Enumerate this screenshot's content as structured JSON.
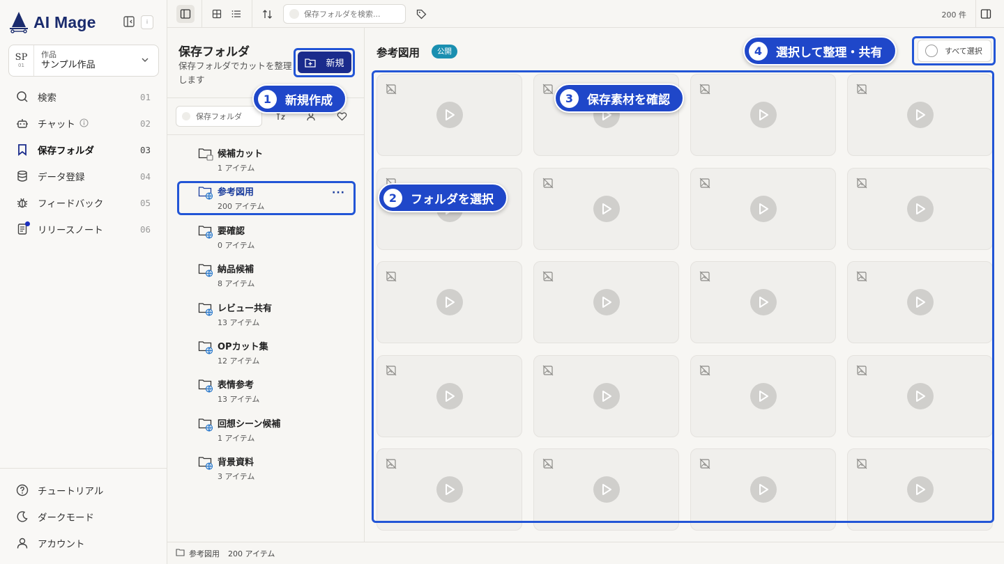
{
  "brand": {
    "name": "AI Mage"
  },
  "sidebar": {
    "kbd_hint": "i",
    "project": {
      "avatar": "SP",
      "avatar_num": "01",
      "label": "作品",
      "name": "サンプル作品"
    },
    "nav": [
      {
        "label": "検索",
        "num": "01",
        "icon": "search-icon"
      },
      {
        "label": "チャット",
        "num": "02",
        "icon": "robot-icon"
      },
      {
        "label": "保存フォルダ",
        "num": "03",
        "icon": "bookmark-icon"
      },
      {
        "label": "データ登録",
        "num": "04",
        "icon": "database-icon"
      },
      {
        "label": "フィードバック",
        "num": "05",
        "icon": "bug-icon"
      },
      {
        "label": "リリースノート",
        "num": "06",
        "icon": "document-icon"
      }
    ],
    "bottom": [
      {
        "label": "チュートリアル",
        "icon": "help-icon"
      },
      {
        "label": "ダークモード",
        "icon": "moon-icon"
      },
      {
        "label": "アカウント",
        "icon": "user-icon"
      }
    ]
  },
  "toolbar": {
    "search_placeholder": "保存フォルダを検索...",
    "count": "200 件"
  },
  "folders": {
    "title": "保存フォルダ",
    "description": "保存フォルダでカットを整理します",
    "new_label": "新規",
    "filter_placeholder": "保存フォルダ",
    "items": [
      {
        "name": "候補カット",
        "count": "1 アイテム"
      },
      {
        "name": "参考図用",
        "count": "200 アイテム"
      },
      {
        "name": "要確認",
        "count": "0 アイテム"
      },
      {
        "name": "納品候補",
        "count": "8 アイテム"
      },
      {
        "name": "レビュー共有",
        "count": "13 アイテム"
      },
      {
        "name": "OPカット集",
        "count": "12 アイテム"
      },
      {
        "name": "表情参考",
        "count": "13 アイテム"
      },
      {
        "name": "回想シーン候補",
        "count": "1 アイテム"
      },
      {
        "name": "背景資料",
        "count": "3 アイテム"
      }
    ]
  },
  "main": {
    "title": "参考図用",
    "badge": "公開",
    "select_all": "すべて選択"
  },
  "status": {
    "folder": "参考図用",
    "count": "200 アイテム"
  },
  "callouts": [
    {
      "num": "1",
      "text": "新規作成"
    },
    {
      "num": "2",
      "text": "フォルダを選択"
    },
    {
      "num": "3",
      "text": "保存素材を確認"
    },
    {
      "num": "4",
      "text": "選択して整理・共有"
    }
  ],
  "colors": {
    "brand": "#1a2b6d",
    "accent": "#1f47c9",
    "badge": "#1a8fb0"
  }
}
